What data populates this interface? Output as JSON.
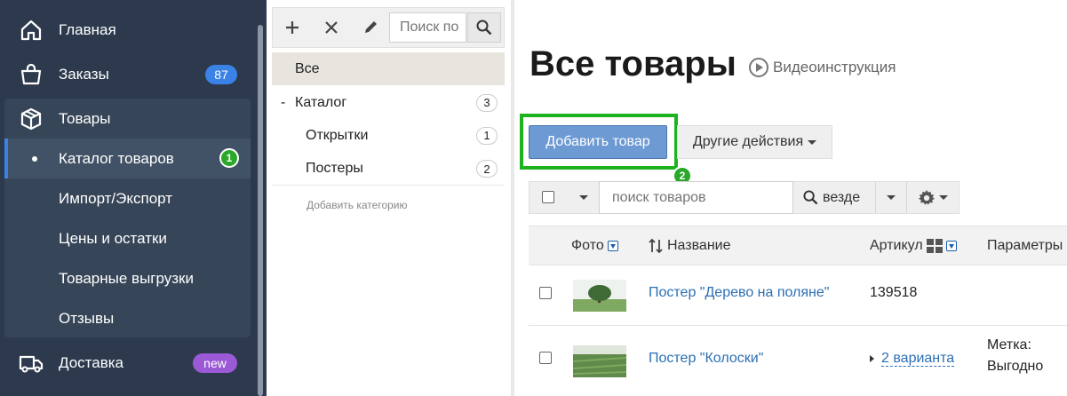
{
  "sidebar": {
    "items": [
      {
        "label": "Главная",
        "icon": "home-icon"
      },
      {
        "label": "Заказы",
        "icon": "shopping-bag-icon",
        "badge": "87"
      },
      {
        "label": "Товары",
        "icon": "box-icon"
      },
      {
        "label": "Доставка",
        "icon": "truck-icon",
        "badge": "new"
      }
    ],
    "goods_submenu": [
      {
        "label": "Каталог товаров",
        "active": true,
        "step": "1"
      },
      {
        "label": "Импорт/Экспорт"
      },
      {
        "label": "Цены и остатки"
      },
      {
        "label": "Товарные выгрузки"
      },
      {
        "label": "Отзывы"
      }
    ]
  },
  "categories": {
    "search_placeholder": "Поиск по",
    "items": [
      {
        "label": "Все",
        "selected": true
      },
      {
        "label": "Каталог",
        "prefix": "-",
        "count": "3"
      },
      {
        "label": "Открытки",
        "count": "1"
      },
      {
        "label": "Постеры",
        "count": "2"
      }
    ],
    "add_label": "Добавить категорию"
  },
  "main": {
    "title": "Все товары",
    "video_label": "Видеоинструкция",
    "add_button": "Добавить товар",
    "add_step": "2",
    "other_actions": "Другие действия",
    "search_placeholder": "поиск товаров",
    "scope_label": "везде",
    "columns": {
      "photo": "Фото",
      "name": "Название",
      "sku": "Артикул",
      "params": "Параметры"
    },
    "rows": [
      {
        "name": "Постер \"Дерево на поляне\"",
        "sku": "139518",
        "params": ""
      },
      {
        "name": "Постер \"Колоски\"",
        "variants": "2 варианта",
        "params_line1": "Метка:",
        "params_line2": "Выгодно"
      }
    ]
  },
  "colors": {
    "sidebar_bg": "#2d3a4e",
    "accent_blue": "#3b82e6",
    "highlight_green": "#1fb21f",
    "link_blue": "#2c6fb3"
  }
}
